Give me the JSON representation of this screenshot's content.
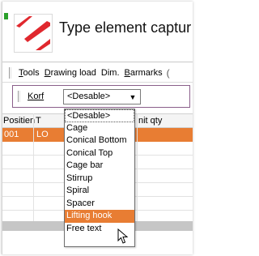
{
  "window": {
    "title": "Type element captur",
    "accent_color": "#e87d33",
    "logo_icon": "red-diagonal-logo"
  },
  "menu": {
    "items": [
      {
        "underlined": "T",
        "rest": "ools"
      },
      {
        "underlined": "D",
        "rest": "rawing load"
      },
      {
        "underlined": "",
        "rest": "Dim."
      },
      {
        "underlined": "B",
        "rest": "armarks"
      }
    ],
    "overflow": "("
  },
  "filter": {
    "label": "Korf",
    "selected_value": "<Desable>"
  },
  "grid": {
    "columns": [
      "Positien",
      "T",
      "nit qty"
    ],
    "rows": [
      {
        "position": "001",
        "type": "LO",
        "selected": true
      }
    ]
  },
  "dropdown": {
    "options": [
      "<Desable>",
      "Cage",
      "Conical Bottom",
      "Conical Top",
      "Cage bar",
      "Stirrup",
      "Spiral",
      "Spacer",
      "Lifting hook",
      "Free text"
    ],
    "highlighted_index": 8
  }
}
